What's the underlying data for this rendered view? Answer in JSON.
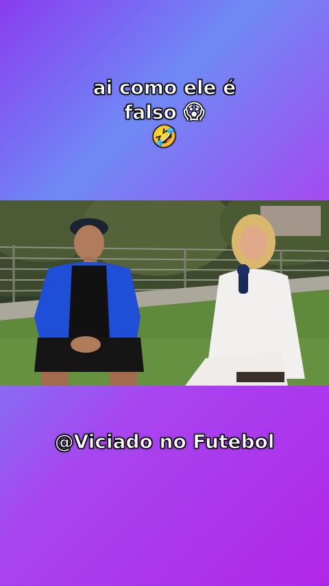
{
  "top_caption": {
    "line1": "ai como ele é",
    "line2": "falso",
    "emoji_scream": "😱",
    "emoji_laugh": "🤣"
  },
  "bottom_caption": {
    "text": "@Viciado no Futebol"
  },
  "video": {
    "description_icon": "interview-video-frame"
  },
  "colors": {
    "gradient_start": "#8a3cf0",
    "gradient_mid": "#6f8af5",
    "gradient_end": "#b026e8"
  }
}
